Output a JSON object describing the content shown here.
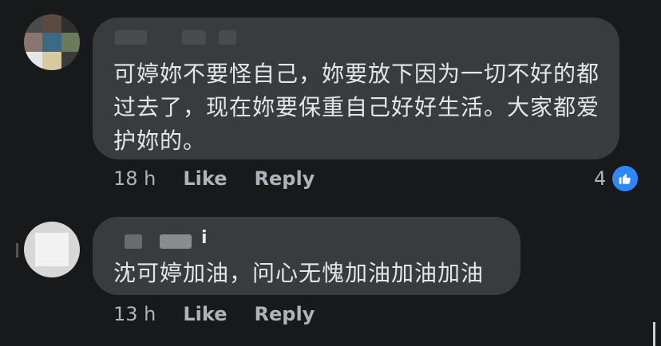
{
  "comments": [
    {
      "name_suffix": "",
      "text": "可婷妳不要怪自己，妳要放下因为一切不好的都过去了，现在妳要保重自己好好生活。大家都爱护妳的。",
      "time": "18 h",
      "like_label": "Like",
      "reply_label": "Reply",
      "reaction_count": "4",
      "reaction_icon": "thumbs-up-icon"
    },
    {
      "name_suffix": "i",
      "text": "沈可婷加油，问心无愧加油加油加油",
      "time": "13 h",
      "like_label": "Like",
      "reply_label": "Reply"
    }
  ],
  "colors": {
    "background": "#18191a",
    "bubble": "#3a3b3c",
    "text": "#e4e6eb",
    "meta": "#b0b3b8",
    "like_blue": "#2d88ff"
  }
}
